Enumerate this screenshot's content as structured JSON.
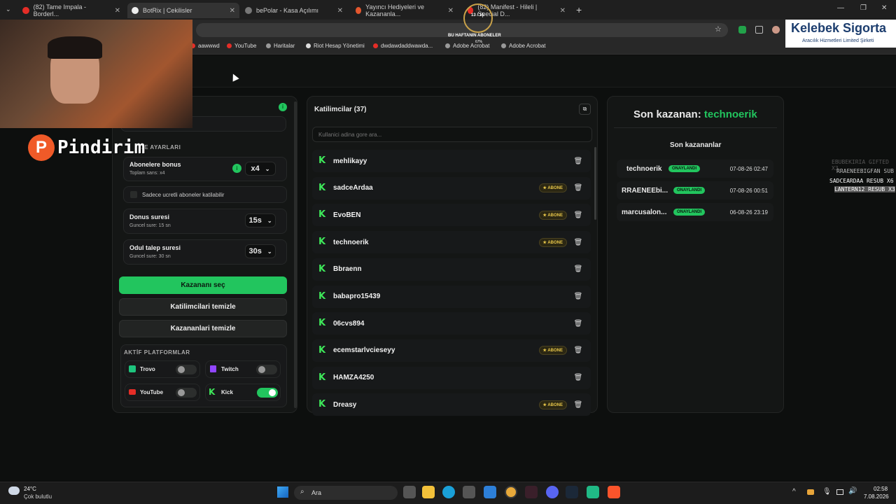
{
  "browser": {
    "tabs": [
      {
        "label": "(82) Tame Impala - Borderl..."
      },
      {
        "label": "BotRix | Cekilisler"
      },
      {
        "label": "bePolar - Kasa Açılımı"
      },
      {
        "label": "Yayıncı Hediyeleri ve Kazananla..."
      },
      {
        "label": "(82) Manifest - Hileli | Special D..."
      }
    ],
    "new_tab": "+",
    "bookmarks": [
      "aawwwd",
      "YouTube",
      "Haritalar",
      "Riot Hesap Yönetimi",
      "dwdawdaddwawda...",
      "Adobe Acrobat",
      "Adobe Acrobat"
    ]
  },
  "overlay": {
    "sub_goal_count": "13 / 15",
    "sub_goal_title": "BU HAFTANIN ABONELER",
    "sub_goal_pct": "67%",
    "sponsor_title": "Kelebek Sigorta",
    "sponsor_subtitle": "Aracılık Hizmetleri Limited Şirketi",
    "pindirim": "Pindirim",
    "events": [
      "EBUBEKIRIA GIFTED X3",
      "RRAENEEBIGFAN SUB",
      "SADCEARDAA RESUB X6",
      "LANTERN12 RESUB X3"
    ]
  },
  "left_panel": {
    "section_title": "...E AYARLARI",
    "sub_bonus_label": "Abonelere bonus",
    "sub_bonus_sub": "Toplam sans: x4",
    "sub_bonus_value": "x4",
    "only_paid_label": "Sadece ucretli aboneler katilabilir",
    "bonus_time_label": "Donus suresi",
    "bonus_time_sub": "Guncel sure: 15 sn",
    "bonus_time_value": "15s",
    "claim_time_label": "Odul talep suresi",
    "claim_time_sub": "Guncel sure: 30 sn",
    "claim_time_value": "30s",
    "pick_winner": "Kazananı seç",
    "clear_participants": "Katilimcilari temizle",
    "clear_winners": "Kazananlari temizle",
    "platforms_title": "AKTİF PLATFORMLAR",
    "platforms": [
      {
        "name": "Trovo",
        "on": false
      },
      {
        "name": "Twitch",
        "on": false
      },
      {
        "name": "YouTube",
        "on": false
      },
      {
        "name": "Kick",
        "on": true
      }
    ]
  },
  "participants": {
    "title": "Katilimcilar (37)",
    "search_placeholder": "Kullanici adina gore ara...",
    "badge_label": "ABONE",
    "items": [
      {
        "name": "mehlikayy",
        "sub": false
      },
      {
        "name": "sadceArdaa",
        "sub": true
      },
      {
        "name": "EvoBEN",
        "sub": true
      },
      {
        "name": "technoerik",
        "sub": true
      },
      {
        "name": "Bbraenn",
        "sub": false
      },
      {
        "name": "babapro15439",
        "sub": false
      },
      {
        "name": "06cvs894",
        "sub": false
      },
      {
        "name": "ecemstarlvcieseyy",
        "sub": true
      },
      {
        "name": "HAMZA4250",
        "sub": false
      },
      {
        "name": "Dreasy",
        "sub": true
      }
    ]
  },
  "winners": {
    "last_winner_prefix": "Son kazanan:",
    "last_winner_name": "technoerik",
    "list_title": "Son kazananlar",
    "status_label": "ONAYLANDI",
    "items": [
      {
        "name": "technoerik",
        "date": "07-08-26 02:47"
      },
      {
        "name": "RRAENEEbi...",
        "date": "07-08-26 00:51"
      },
      {
        "name": "marcusalon...",
        "date": "06-08-26 23:19"
      }
    ]
  },
  "taskbar": {
    "weather_temp": "24°C",
    "weather_desc": "Çok bulutlu",
    "search_label": "Ara",
    "time": "02:58",
    "date": "7.08.2026"
  },
  "colors": {
    "accent": "#22c55e",
    "kick": "#3ee85a",
    "abone": "#e9c84a"
  }
}
